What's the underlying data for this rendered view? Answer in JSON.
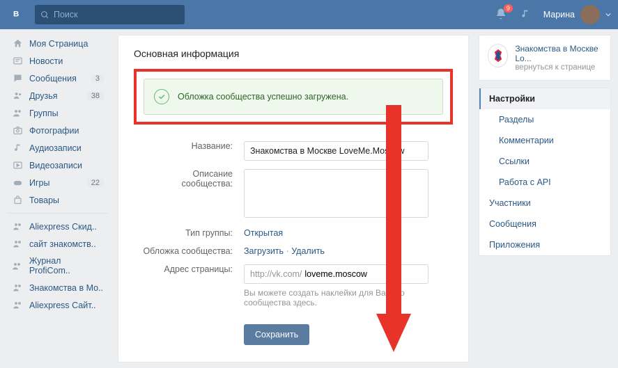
{
  "header": {
    "search_placeholder": "Поиск",
    "notif_count": "9",
    "user_name": "Марина"
  },
  "sidebar": {
    "items": [
      {
        "label": "Моя Страница"
      },
      {
        "label": "Новости"
      },
      {
        "label": "Сообщения",
        "count": "3"
      },
      {
        "label": "Друзья",
        "count": "38"
      },
      {
        "label": "Группы"
      },
      {
        "label": "Фотографии"
      },
      {
        "label": "Аудиозаписи"
      },
      {
        "label": "Видеозаписи"
      },
      {
        "label": "Игры",
        "count": "22"
      },
      {
        "label": "Товары"
      }
    ],
    "groups": [
      {
        "label": "Aliexpress Скид.."
      },
      {
        "label": "сайт знакомств.."
      },
      {
        "label": "Журнал ProfiCom.."
      },
      {
        "label": "Знакомства в Мо.."
      },
      {
        "label": "Aliexpress Сайт.."
      }
    ]
  },
  "main": {
    "title": "Основная информация",
    "alert": "Обложка сообщества успешно загружена.",
    "fields": {
      "name_label": "Название:",
      "name_value": "Знакомства в Москве LoveMe.Moscow",
      "desc_label": "Описание сообщества:",
      "desc_value": "",
      "type_label": "Тип группы:",
      "type_value": "Открытая",
      "cover_label": "Обложка сообщества:",
      "cover_upload": "Загрузить",
      "cover_delete": "Удалить",
      "addr_label": "Адрес страницы:",
      "addr_prefix": "http://vk.com/",
      "addr_value": "loveme.moscow",
      "hint": "Вы можете создать наклейки для Вашего сообщества здесь.",
      "save": "Сохранить"
    }
  },
  "right": {
    "group_name": "Знакомства в Москве Lo...",
    "group_back": "вернуться к странице",
    "nav": [
      {
        "label": "Настройки",
        "active": true
      },
      {
        "label": "Разделы",
        "sub": true
      },
      {
        "label": "Комментарии",
        "sub": true
      },
      {
        "label": "Ссылки",
        "sub": true
      },
      {
        "label": "Работа с API",
        "sub": true
      },
      {
        "label": "Участники"
      },
      {
        "label": "Сообщения"
      },
      {
        "label": "Приложения"
      }
    ]
  }
}
